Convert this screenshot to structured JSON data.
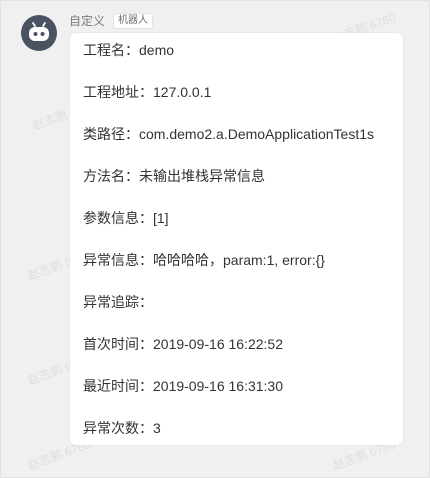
{
  "sender": {
    "name": "自定义",
    "tag": "机器人"
  },
  "watermark": "赵志鹏 6760",
  "message": {
    "lines": [
      "工程名：demo",
      "工程地址：127.0.0.1",
      "类路径：com.demo2.a.DemoApplicationTest1s",
      "方法名：未输出堆栈异常信息",
      "参数信息：[1]",
      "异常信息：哈哈哈哈，param:1, error:{}",
      "异常追踪：",
      "首次时间：2019-09-16 16:22:52",
      "最近时间：2019-09-16 16:31:30",
      "异常次数：3"
    ]
  },
  "colors": {
    "avatar": "#4a5161",
    "background": "#f0f0f0",
    "bubble": "#ffffff",
    "text": "#333333"
  }
}
